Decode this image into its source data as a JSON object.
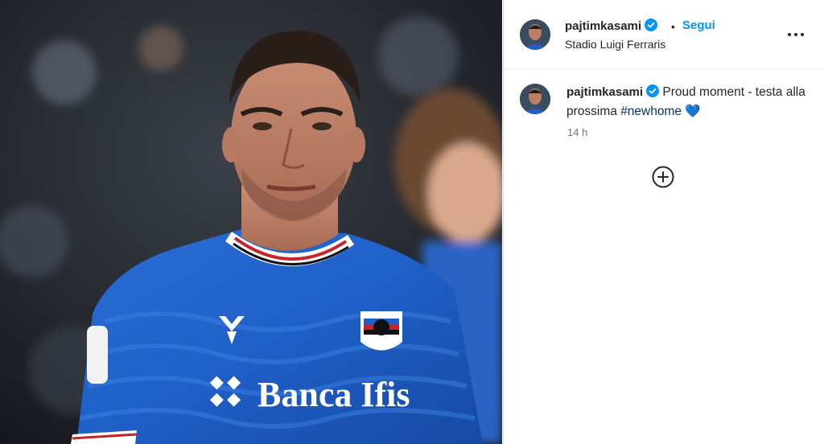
{
  "post": {
    "image_alt": "Player in blue Sampdoria jersey with Banca Ifis sponsor",
    "jersey_sponsor": "Banca Ifis"
  },
  "header": {
    "username": "pajtimkasami",
    "separator": "•",
    "follow_label": "Segui",
    "location": "Stadio Luigi Ferraris"
  },
  "comment": {
    "username": "pajtimkasami",
    "text": "Proud moment - testa alla prossima ",
    "hashtag": "#newhome",
    "emoji": "💙",
    "timestamp": "14 h"
  },
  "colors": {
    "follow": "#0095f6",
    "verified": "#0095f6",
    "hashtag": "#00376b",
    "timestamp": "#737373",
    "jersey": "#1f5fc8"
  },
  "icons": {
    "verified": "verified-badge-icon",
    "more": "more-options-icon",
    "add": "add-circle-icon"
  }
}
